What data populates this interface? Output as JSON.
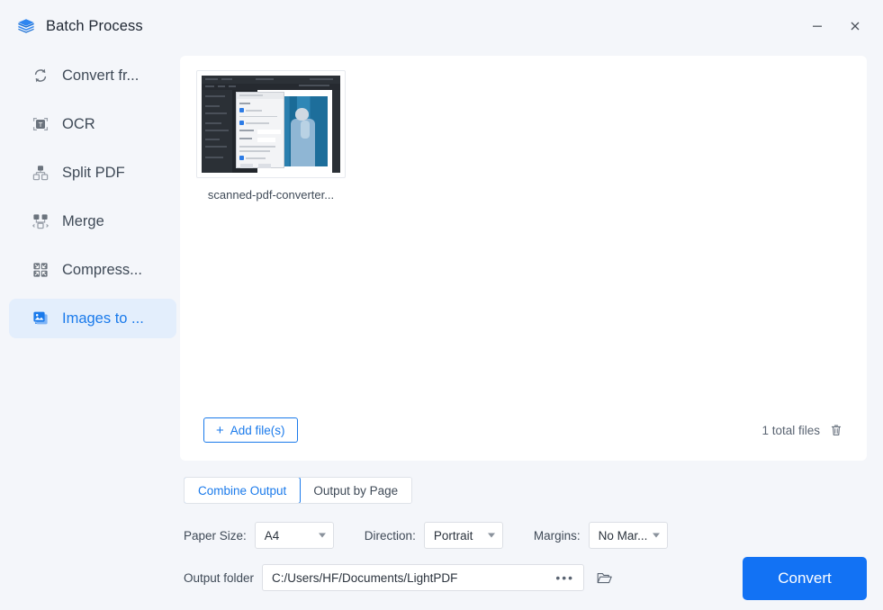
{
  "window": {
    "title": "Batch Process",
    "logo_icon": "layers-stack-icon",
    "minimize_icon": "minimize-icon",
    "close_icon": "close-icon",
    "accent_color": "#1a7aeb",
    "convert_button_color": "#1272f4",
    "active_item_bg": "#e3eefc",
    "background_color": "#f4f6fa"
  },
  "sidebar": {
    "items": [
      {
        "label": "Convert fr...",
        "icon": "convert-refresh-icon",
        "active": false
      },
      {
        "label": "OCR",
        "icon": "ocr-text-frame-icon",
        "active": false
      },
      {
        "label": "Split PDF",
        "icon": "split-pdf-icon",
        "active": false
      },
      {
        "label": "Merge",
        "icon": "merge-icon",
        "active": false
      },
      {
        "label": "Compress...",
        "icon": "compress-icon",
        "active": false
      },
      {
        "label": "Images to ...",
        "icon": "images-to-pdf-icon",
        "active": true
      }
    ]
  },
  "files": {
    "items": [
      {
        "name": "scanned-pdf-converter...",
        "thumbnail": "pdf-editor-screenshot-thumbnail"
      }
    ],
    "add_button": {
      "label": "Add file(s)",
      "icon": "plus-icon"
    },
    "count_label": "1 total files",
    "delete_icon": "trash-icon"
  },
  "output_mode": {
    "options": [
      "Combine Output",
      "Output by Page"
    ],
    "selected": "Combine Output"
  },
  "settings": {
    "paper_size": {
      "label": "Paper Size:",
      "value": "A4",
      "caret_icon": "chevron-down-icon"
    },
    "direction": {
      "label": "Direction:",
      "value": "Portrait",
      "caret_icon": "chevron-down-icon"
    },
    "margins": {
      "label": "Margins:",
      "value": "No Mar...",
      "caret_icon": "chevron-down-icon"
    },
    "output_folder": {
      "label": "Output folder",
      "value": "C:/Users/HF/Documents/LightPDF",
      "more_icon": "ellipsis-icon",
      "browse_icon": "open-folder-icon"
    }
  },
  "actions": {
    "convert_label": "Convert"
  }
}
